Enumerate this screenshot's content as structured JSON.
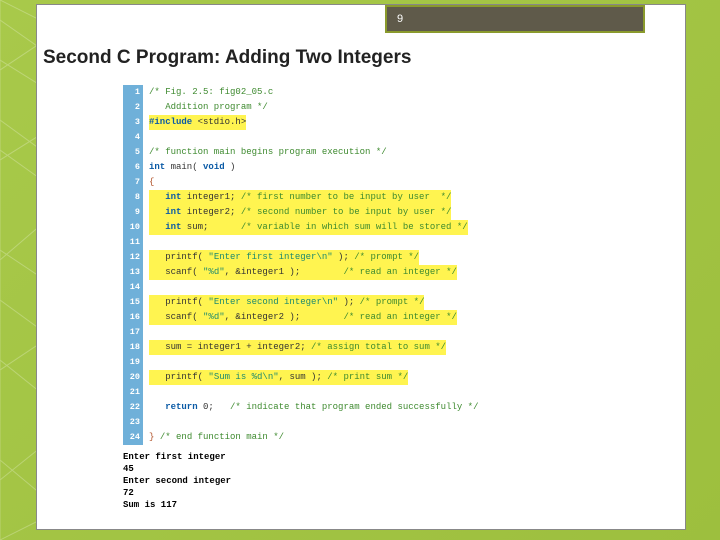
{
  "page_number": "9",
  "title": "Second C Program: Adding Two Integers",
  "code_lines": [
    {
      "n": "1",
      "hl": false,
      "segs": [
        {
          "t": "/* Fig. 2.5: fig02_05.c",
          "c": "cm"
        }
      ]
    },
    {
      "n": "2",
      "hl": false,
      "segs": [
        {
          "t": "   Addition program */",
          "c": "cm"
        }
      ]
    },
    {
      "n": "3",
      "hl": true,
      "segs": [
        {
          "t": "#include ",
          "c": "kw"
        },
        {
          "t": "<stdio.h>",
          "c": ""
        }
      ]
    },
    {
      "n": "4",
      "hl": false,
      "segs": []
    },
    {
      "n": "5",
      "hl": false,
      "segs": [
        {
          "t": "/* function main begins program execution */",
          "c": "cm"
        }
      ]
    },
    {
      "n": "6",
      "hl": false,
      "segs": [
        {
          "t": "int",
          "c": "kw"
        },
        {
          "t": " main( ",
          "c": ""
        },
        {
          "t": "void",
          "c": "kw"
        },
        {
          "t": " )",
          "c": ""
        }
      ]
    },
    {
      "n": "7",
      "hl": false,
      "segs": [
        {
          "t": "{",
          "c": "br"
        }
      ]
    },
    {
      "n": "8",
      "hl": true,
      "segs": [
        {
          "t": "   ",
          "c": ""
        },
        {
          "t": "int",
          "c": "kw"
        },
        {
          "t": " integer1; ",
          "c": ""
        },
        {
          "t": "/* first number to be input by user  */",
          "c": "cm"
        }
      ]
    },
    {
      "n": "9",
      "hl": true,
      "segs": [
        {
          "t": "   ",
          "c": ""
        },
        {
          "t": "int",
          "c": "kw"
        },
        {
          "t": " integer2; ",
          "c": ""
        },
        {
          "t": "/* second number to be input by user */",
          "c": "cm"
        }
      ]
    },
    {
      "n": "10",
      "hl": true,
      "segs": [
        {
          "t": "   ",
          "c": ""
        },
        {
          "t": "int",
          "c": "kw"
        },
        {
          "t": " sum;      ",
          "c": ""
        },
        {
          "t": "/* variable in which sum will be stored */",
          "c": "cm"
        }
      ]
    },
    {
      "n": "11",
      "hl": false,
      "segs": []
    },
    {
      "n": "12",
      "hl": true,
      "segs": [
        {
          "t": "   printf( ",
          "c": ""
        },
        {
          "t": "\"Enter first integer\\n\"",
          "c": "str"
        },
        {
          "t": " ); ",
          "c": ""
        },
        {
          "t": "/* prompt */",
          "c": "cm"
        }
      ]
    },
    {
      "n": "13",
      "hl": true,
      "segs": [
        {
          "t": "   scanf( ",
          "c": ""
        },
        {
          "t": "\"%d\"",
          "c": "str"
        },
        {
          "t": ", &integer1 );        ",
          "c": ""
        },
        {
          "t": "/* read an integer */",
          "c": "cm"
        }
      ]
    },
    {
      "n": "14",
      "hl": false,
      "segs": []
    },
    {
      "n": "15",
      "hl": true,
      "segs": [
        {
          "t": "   printf( ",
          "c": ""
        },
        {
          "t": "\"Enter second integer\\n\"",
          "c": "str"
        },
        {
          "t": " ); ",
          "c": ""
        },
        {
          "t": "/* prompt */",
          "c": "cm"
        }
      ]
    },
    {
      "n": "16",
      "hl": true,
      "segs": [
        {
          "t": "   scanf( ",
          "c": ""
        },
        {
          "t": "\"%d\"",
          "c": "str"
        },
        {
          "t": ", &integer2 );        ",
          "c": ""
        },
        {
          "t": "/* read an integer */",
          "c": "cm"
        }
      ]
    },
    {
      "n": "17",
      "hl": false,
      "segs": []
    },
    {
      "n": "18",
      "hl": true,
      "segs": [
        {
          "t": "   sum = integer1 + integer2; ",
          "c": ""
        },
        {
          "t": "/* assign total to sum */",
          "c": "cm"
        }
      ]
    },
    {
      "n": "19",
      "hl": false,
      "segs": []
    },
    {
      "n": "20",
      "hl": true,
      "segs": [
        {
          "t": "   printf( ",
          "c": ""
        },
        {
          "t": "\"Sum is %d\\n\"",
          "c": "str"
        },
        {
          "t": ", sum ); ",
          "c": ""
        },
        {
          "t": "/* print sum */",
          "c": "cm"
        }
      ]
    },
    {
      "n": "21",
      "hl": false,
      "segs": []
    },
    {
      "n": "22",
      "hl": false,
      "segs": [
        {
          "t": "   ",
          "c": ""
        },
        {
          "t": "return",
          "c": "kw"
        },
        {
          "t": " ",
          "c": ""
        },
        {
          "t": "0",
          "c": ""
        },
        {
          "t": ";   ",
          "c": ""
        },
        {
          "t": "/* indicate that program ended successfully */",
          "c": "cm"
        }
      ]
    },
    {
      "n": "23",
      "hl": false,
      "segs": []
    },
    {
      "n": "24",
      "hl": false,
      "segs": [
        {
          "t": "}",
          "c": "br"
        },
        {
          "t": " ",
          "c": ""
        },
        {
          "t": "/* end function main */",
          "c": "cm"
        }
      ]
    }
  ],
  "output_lines": [
    "Enter first integer",
    "45",
    "Enter second integer",
    "72",
    "Sum is 117"
  ]
}
